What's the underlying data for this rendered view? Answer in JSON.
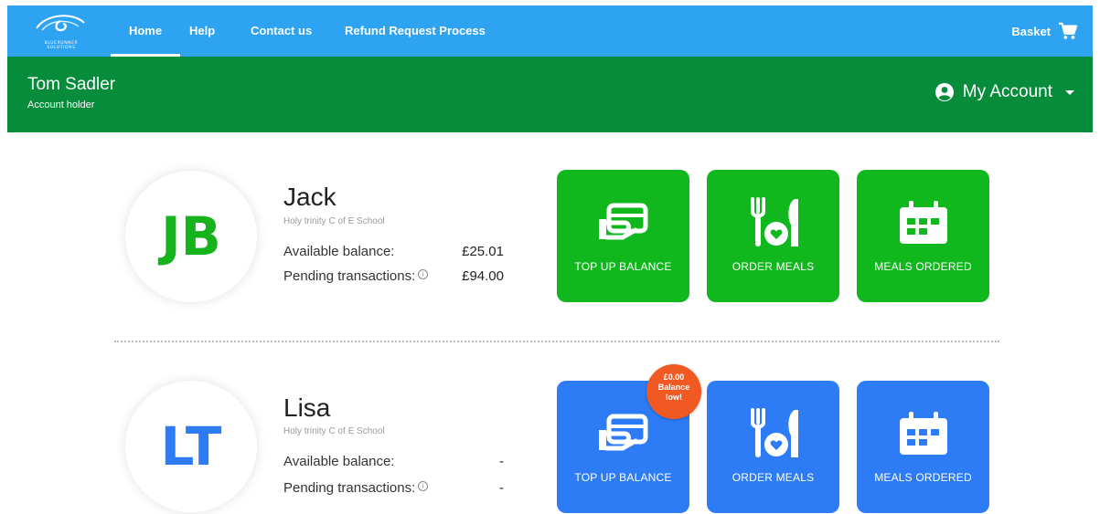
{
  "nav": {
    "logo_text": "BLUERUNNER SOLUTIONS",
    "items": [
      {
        "label": "Home"
      },
      {
        "label": "Help"
      },
      {
        "label": "Contact us"
      },
      {
        "label": "Refund Request Process"
      }
    ],
    "active": "Home",
    "basket_label": "Basket",
    "basket_icon": "cart-icon",
    "color": "#2da3f2"
  },
  "header": {
    "name": "Tom Sadler",
    "role": "Account holder",
    "account_label": "My Account",
    "account_icon": "user-circle-icon",
    "color": "#068c3b"
  },
  "children": [
    {
      "initials": "JB",
      "name": "Jack",
      "school": "Holy trinity C of E School",
      "balance_label": "Available balance:",
      "balance_value": "£25.01",
      "pending_label": "Pending transactions:",
      "pending_value": "£94.00",
      "accent": "#10b81d",
      "tiles": [
        {
          "label": "TOP UP BALANCE",
          "icon": "wallet-icon"
        },
        {
          "label": "ORDER MEALS",
          "icon": "cutlery-icon"
        },
        {
          "label": "MEALS ORDERED",
          "icon": "calendar-icon"
        }
      ]
    },
    {
      "initials": "LT",
      "name": "Lisa",
      "school": "Holy trinity C of E School",
      "balance_label": "Available balance:",
      "balance_value": "-",
      "pending_label": "Pending transactions:",
      "pending_value": "-",
      "accent": "#2d7cf6",
      "badge": {
        "amount": "£0.00",
        "line1": "Balance",
        "line2": "low!",
        "color": "#f05a22"
      },
      "tiles": [
        {
          "label": "TOP UP BALANCE",
          "icon": "wallet-icon"
        },
        {
          "label": "ORDER MEALS",
          "icon": "cutlery-icon"
        },
        {
          "label": "MEALS ORDERED",
          "icon": "calendar-icon"
        }
      ]
    }
  ]
}
